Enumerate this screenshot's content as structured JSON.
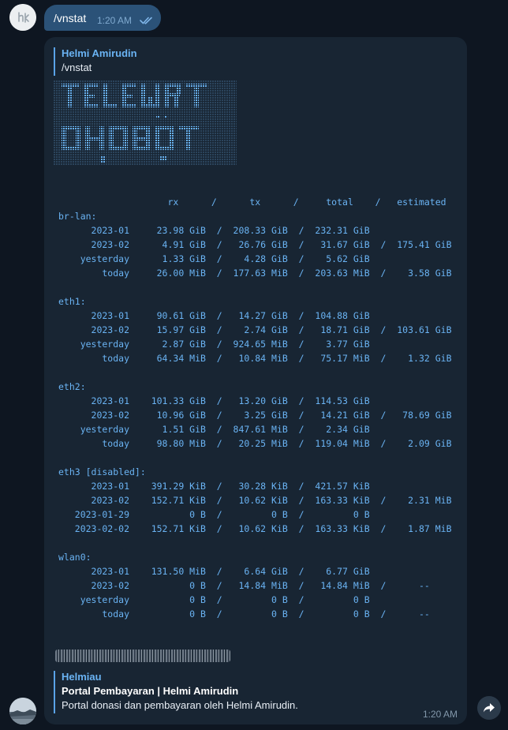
{
  "outgoing": {
    "command": "/vnstat",
    "time": "1:20 AM",
    "status_icon": "double-check-icon"
  },
  "incoming": {
    "reply": {
      "author": "Helmi Amirudin",
      "text": "/vnstat"
    },
    "banner": {
      "lines": [
        "TELEWRT",
        "OHOBOT"
      ],
      "style": "ascii-art"
    },
    "vnstat_output": "                    rx      /      tx      /     total    /   estimated\nbr-lan:\n      2023-01     23.98 GiB  /  208.33 GiB  /  232.31 GiB\n      2023-02      4.91 GiB  /   26.76 GiB  /   31.67 GiB  /  175.41 GiB\n    yesterday      1.33 GiB  /    4.28 GiB  /    5.62 GiB\n        today     26.00 MiB  /  177.63 MiB  /  203.63 MiB  /    3.58 GiB\n\neth1:\n      2023-01     90.61 GiB  /   14.27 GiB  /  104.88 GiB\n      2023-02     15.97 GiB  /    2.74 GiB  /   18.71 GiB  /  103.61 GiB\n    yesterday      2.87 GiB  /  924.65 MiB  /    3.77 GiB\n        today     64.34 MiB  /   10.84 MiB  /   75.17 MiB  /    1.32 GiB\n\neth2:\n      2023-01    101.33 GiB  /   13.20 GiB  /  114.53 GiB\n      2023-02     10.96 GiB  /    3.25 GiB  /   14.21 GiB  /   78.69 GiB\n    yesterday      1.51 GiB  /  847.61 MiB  /    2.34 GiB\n        today     98.80 MiB  /   20.25 MiB  /  119.04 MiB  /    2.09 GiB\n\neth3 [disabled]:\n      2023-01    391.29 KiB  /   30.28 KiB  /  421.57 KiB\n      2023-02    152.71 KiB  /   10.62 KiB  /  163.33 KiB  /    2.31 MiB\n   2023-01-29           0 B  /         0 B  /         0 B\n   2023-02-02    152.71 KiB  /   10.62 KiB  /  163.33 KiB  /    1.87 MiB\n\nwlan0:\n      2023-01    131.50 MiB  /    6.64 GiB  /    6.77 GiB\n      2023-02           0 B  /   14.84 MiB  /   14.84 MiB  /      --\n    yesterday           0 B  /         0 B  /         0 B\n        today           0 B  /         0 B  /         0 B  /      --",
    "link_preview": {
      "site": "Helmiau",
      "title": "Portal Pembayaran | Helmi Amirudin",
      "description": "Portal donasi dan pembayaran oleh Helmi Amirudin."
    },
    "time": "1:20 AM"
  },
  "forward_icon": "forward-icon",
  "colors": {
    "background": "#0e1621",
    "outgoing_bubble": "#2b5278",
    "incoming_bubble": "#182533",
    "accent": "#6ab3f3"
  }
}
